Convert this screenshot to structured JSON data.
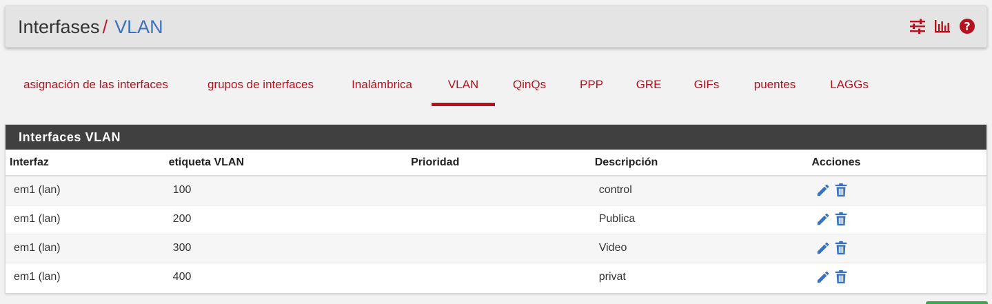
{
  "header": {
    "breadcrumb_root": "Interfases",
    "breadcrumb_separator": "/",
    "breadcrumb_current": "VLAN",
    "icons": [
      "sliders-icon",
      "bar-chart-icon",
      "help-icon"
    ]
  },
  "tabs": [
    {
      "label": "asignación de las interfaces",
      "active": false
    },
    {
      "label": "grupos de interfaces",
      "active": false
    },
    {
      "label": "Inalámbrica",
      "active": false
    },
    {
      "label": "VLAN",
      "active": true
    },
    {
      "label": "QinQs",
      "active": false
    },
    {
      "label": "PPP",
      "active": false
    },
    {
      "label": "GRE",
      "active": false
    },
    {
      "label": "GIFs",
      "active": false
    },
    {
      "label": "puentes",
      "active": false
    },
    {
      "label": "LAGGs",
      "active": false
    }
  ],
  "panel": {
    "title": "Interfaces VLAN",
    "columns": [
      "Interfaz",
      "etiqueta VLAN",
      "Prioridad",
      "Descripción",
      "Acciones"
    ],
    "rows": [
      {
        "interface": "em1 (lan)",
        "tag": "100",
        "priority": "",
        "description": "control"
      },
      {
        "interface": "em1 (lan)",
        "tag": "200",
        "priority": "",
        "description": "Publica"
      },
      {
        "interface": "em1 (lan)",
        "tag": "300",
        "priority": "",
        "description": "Video"
      },
      {
        "interface": "em1 (lan)",
        "tag": "400",
        "priority": "",
        "description": "privat"
      }
    ],
    "row_actions": [
      "edit-pencil-icon",
      "delete-trash-icon"
    ]
  },
  "colors": {
    "accent_red": "#b4121f",
    "link_blue": "#3a72c0",
    "panel_heading": "#404040",
    "action_green": "#3ea64b"
  }
}
